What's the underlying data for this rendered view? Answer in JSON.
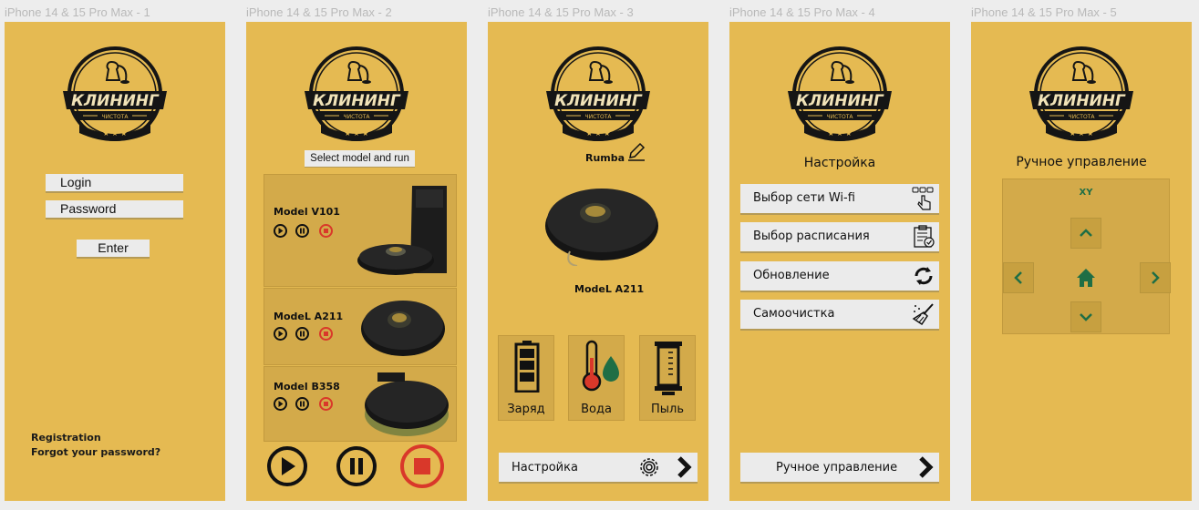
{
  "frames": [
    {
      "title": "iPhone 14 & 15 Pro Max - 1"
    },
    {
      "title": "iPhone 14 & 15 Pro Max - 2"
    },
    {
      "title": "iPhone 14 & 15 Pro Max - 3"
    },
    {
      "title": "iPhone 14 & 15 Pro Max - 4"
    },
    {
      "title": "iPhone 14 & 15 Pro Max - 5"
    }
  ],
  "logo": {
    "brand": "КЛИНИНГ",
    "tagline": "ЧИСТОТА"
  },
  "login": {
    "login_label": "Login",
    "password_label": "Password",
    "enter_label": "Enter",
    "registration_label": "Registration",
    "forgot_label": "Forgot your password?"
  },
  "models_screen": {
    "select_label": "Select model and run",
    "models": [
      {
        "name": "Model V101"
      },
      {
        "name": "ModeL A211"
      },
      {
        "name": "Model B358"
      }
    ]
  },
  "device_screen": {
    "device_name": "Rumba",
    "model_name": "ModeL A211",
    "stats": [
      {
        "label": "Заряд",
        "icon": "battery-icon"
      },
      {
        "label": "Вода",
        "icon": "water-thermometer-icon"
      },
      {
        "label": "Пыль",
        "icon": "dust-container-icon"
      }
    ],
    "settings_label": "Настройка"
  },
  "settings_screen": {
    "heading": "Настройка",
    "items": [
      {
        "label": "Выбор сети Wi-fi",
        "icon": "touch-icon"
      },
      {
        "label": "Выбор расписания",
        "icon": "clipboard-check-icon"
      },
      {
        "label": "Обновление",
        "icon": "refresh-icon"
      },
      {
        "label": "Самоочистка",
        "icon": "broom-icon"
      }
    ],
    "manual_label": "Ручное управление"
  },
  "manual_screen": {
    "heading": "Ручное управление",
    "coord_label": "XY"
  },
  "colors": {
    "background": "#e5ba52",
    "panel": "#d3aa4a",
    "stop": "#d9382a",
    "button": "#ebebeb",
    "accent_green": "#1f6e45"
  }
}
